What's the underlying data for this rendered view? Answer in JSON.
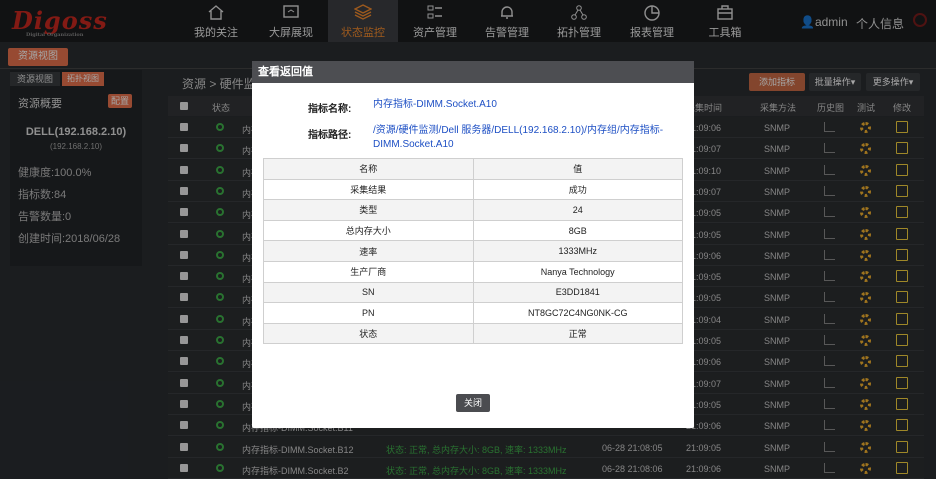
{
  "brand": {
    "logo": "Digoss",
    "tagline": "Digital Organization"
  },
  "nav": [
    {
      "label": "我的关注",
      "icon": "home-icon"
    },
    {
      "label": "大屏展现",
      "icon": "screen-icon"
    },
    {
      "label": "状态监控",
      "icon": "layers-icon",
      "active": true
    },
    {
      "label": "资产管理",
      "icon": "list-icon"
    },
    {
      "label": "告警管理",
      "icon": "bell-icon"
    },
    {
      "label": "拓扑管理",
      "icon": "topology-icon"
    },
    {
      "label": "报表管理",
      "icon": "pie-chart-icon"
    },
    {
      "label": "工具箱",
      "icon": "toolbox-icon"
    }
  ],
  "user": {
    "name": "admin",
    "profile": "个人信息"
  },
  "subtab": "资源视图",
  "left_panel": {
    "tab1": "资源视图",
    "tab2": "拓扑视图",
    "title": "资源概要",
    "config": "配置",
    "host": "DELL(192.168.2.10)",
    "ip": "(192.168.2.10)",
    "health": "健康度:100.0%",
    "metric_count": "指标数:84",
    "alarm_count": "告警数量:0",
    "created": "创建时间:2018/06/28"
  },
  "main": {
    "breadcrumb": "资源 > 硬件监",
    "add_btn": "添加指标",
    "batch_btn": "批量操作▾",
    "more_btn": "更多操作▾",
    "headers": [
      "状态",
      "采集时间",
      "采集方法",
      "历史图",
      "测试",
      "修改"
    ],
    "rows": [
      {
        "name": "内存",
        "collect": "21:09:06",
        "method": "SNMP"
      },
      {
        "name": "内存",
        "collect": "21:09:07",
        "method": "SNMP"
      },
      {
        "name": "内存",
        "collect": "21:09:10",
        "method": "SNMP"
      },
      {
        "name": "内存",
        "collect": "21:09:07",
        "method": "SNMP"
      },
      {
        "name": "内存",
        "collect": "21:09:05",
        "method": "SNMP"
      },
      {
        "name": "内存",
        "collect": "21:09:05",
        "method": "SNMP"
      },
      {
        "name": "内存",
        "collect": "21:09:06",
        "method": "SNMP"
      },
      {
        "name": "内存",
        "collect": "21:09:05",
        "method": "SNMP"
      },
      {
        "name": "内存",
        "collect": "21:09:05",
        "method": "SNMP"
      },
      {
        "name": "内存",
        "collect": "21:09:04",
        "method": "SNMP"
      },
      {
        "name": "内存",
        "collect": "21:09:05",
        "method": "SNMP"
      },
      {
        "name": "内存",
        "collect": "21:09:06",
        "method": "SNMP"
      },
      {
        "name": "内存",
        "collect": "21:09:07",
        "method": "SNMP"
      },
      {
        "name": "内存",
        "collect": "21:09:05",
        "method": "SNMP"
      },
      {
        "name": "内存指标-DIMM.Socket.B11",
        "collect": "21:09:06",
        "method": "SNMP"
      },
      {
        "name": "内存指标-DIMM.Socket.B12",
        "status": "状态: 正常, 总内存大小: 8GB, 速率: 1333MHz",
        "time": "06-28 21:08:05",
        "collect": "21:09:05",
        "method": "SNMP"
      },
      {
        "name": "内存指标-DIMM.Socket.B2",
        "status": "状态: 正常, 总内存大小: 8GB, 速率: 1333MHz",
        "time": "06-28 21:08:06",
        "collect": "21:09:06",
        "method": "SNMP"
      }
    ]
  },
  "modal": {
    "title": "查看返回值",
    "name_label": "指标名称:",
    "name_value": "内存指标-DIMM.Socket.A10",
    "path_label": "指标路径:",
    "path_value_1": "/资源/硬件监测/Dell 服务器/DELL(192.168.2.10)/内存组/内存指标-",
    "path_value_2": "DIMM.Socket.A10",
    "table": [
      {
        "k": "名称",
        "v": "值"
      },
      {
        "k": "采集结果",
        "v": "成功"
      },
      {
        "k": "类型",
        "v": "24"
      },
      {
        "k": "总内存大小",
        "v": "8GB"
      },
      {
        "k": "速率",
        "v": "1333MHz"
      },
      {
        "k": "生产厂商",
        "v": "Nanya Technology"
      },
      {
        "k": "SN",
        "v": "E3DD1841"
      },
      {
        "k": "PN",
        "v": "NT8GC72C4NG0NK-CG"
      },
      {
        "k": "状态",
        "v": "正常"
      }
    ],
    "close": "关闭"
  },
  "colors": {
    "accent": "#f28a2e",
    "orange_btn": "#e8724d",
    "link": "#1d4fc4",
    "ok_green": "#3fb04a"
  }
}
